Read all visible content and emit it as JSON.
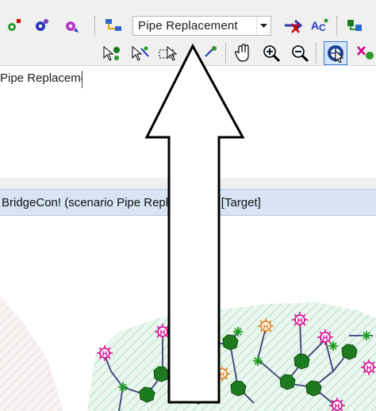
{
  "toolbar": {
    "scenario_value": "Pipe Replacement",
    "icons": [
      "add-node-icon",
      "gear-blue-icon",
      "gear-pink-icon",
      "network-icon",
      "network-x-icon",
      "abc-text-icon",
      "network-green-icon"
    ]
  },
  "toolbar2": {
    "icons": [
      "select-green-icon",
      "select-blue-icon",
      "select-box-icon",
      "select-star-icon",
      "pan-hand-icon",
      "zoom-in-icon",
      "zoom-out-icon",
      "identify-icon",
      "pink-tool-icon"
    ]
  },
  "name_field": {
    "value": "Pipe Replacemer"
  },
  "map_window": {
    "title": "BridgeCon! (scenario Pipe Replacement)  [Target]"
  },
  "colors": {
    "toolbar_bg": "#f0f0f0",
    "titlebar_bg": "#d6e4f3",
    "node_pink": "#d8008f",
    "node_orange": "#e87a1a",
    "node_green": "#1e7a1e",
    "pipe": "#3b3f7a"
  }
}
